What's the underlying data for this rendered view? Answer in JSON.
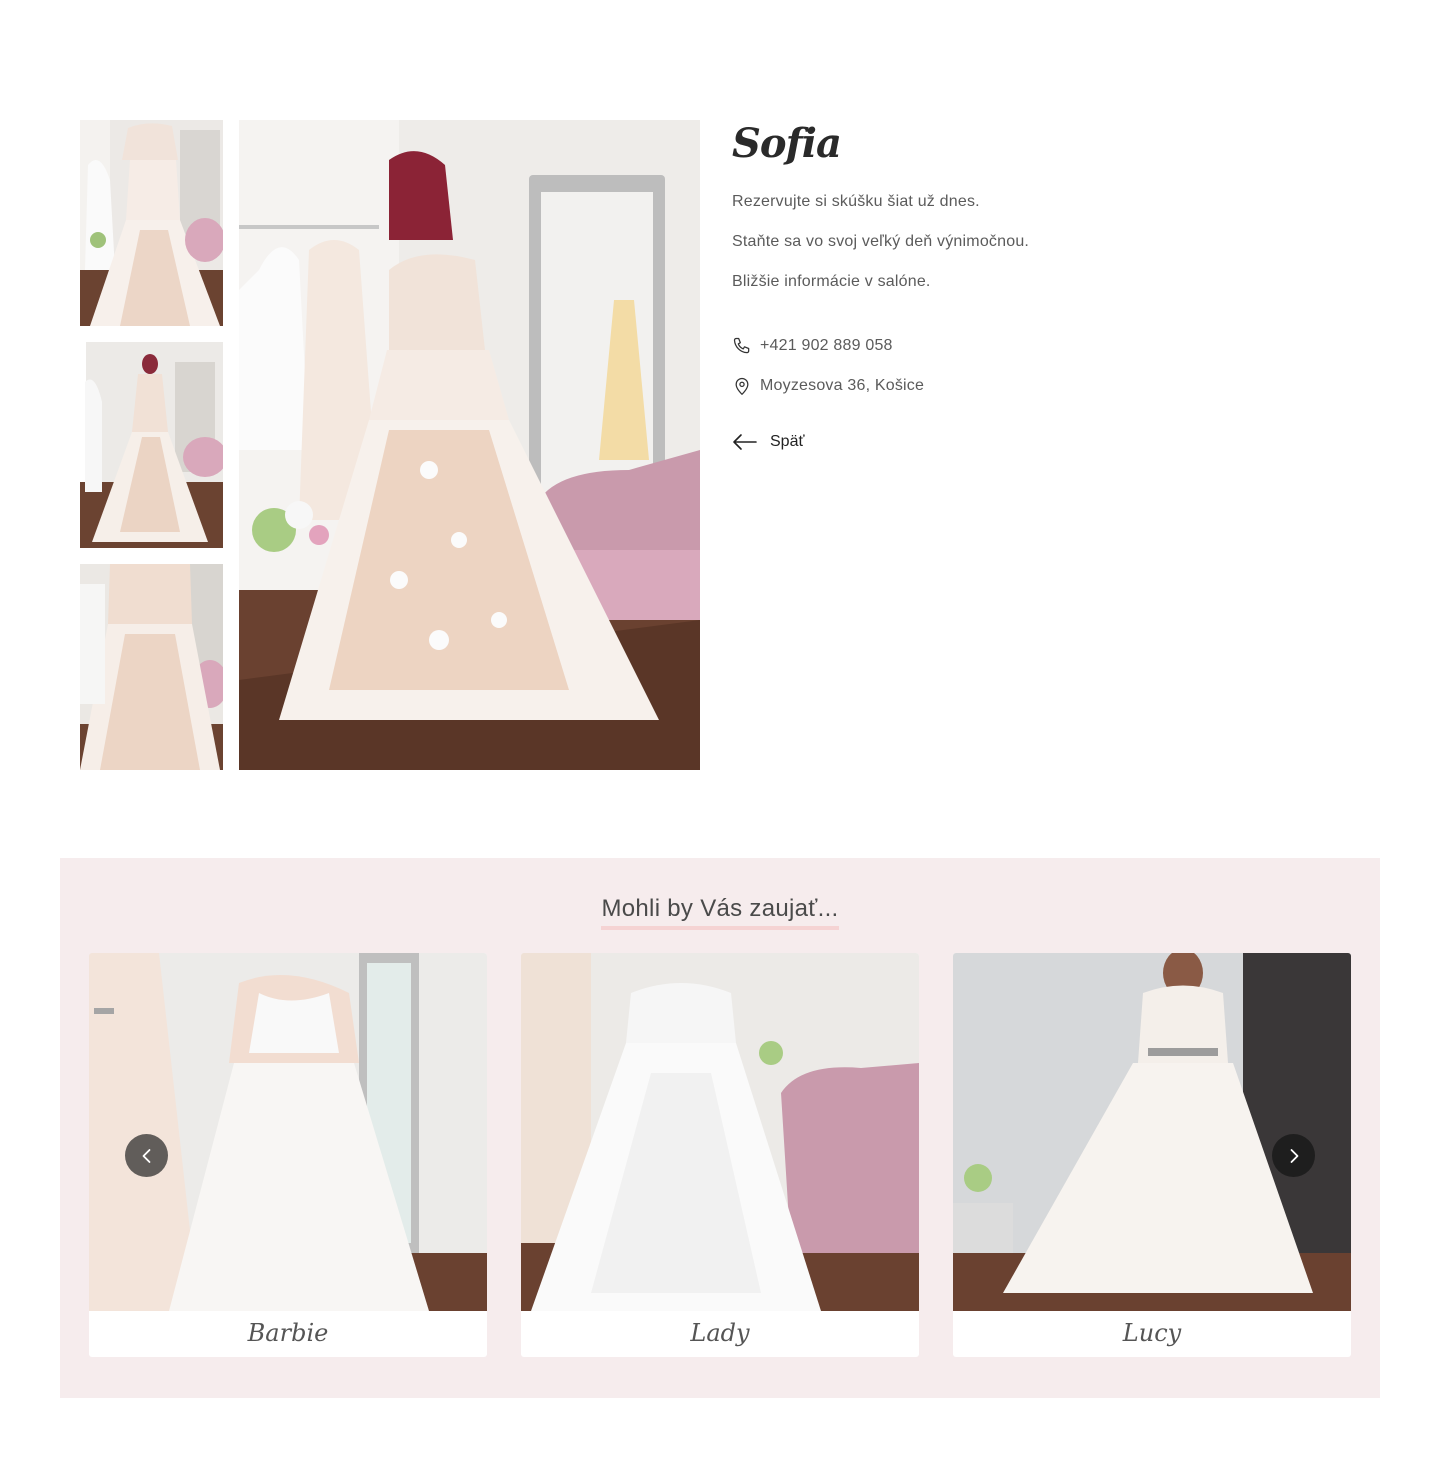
{
  "product": {
    "name": "Sofia",
    "description": [
      "Rezervujte si skúšku šiat už dnes.",
      "Staňte sa vo svoj veľký deň výnimočnou.",
      "Bližšie informácie v salóne."
    ],
    "phone": "+421 902 889 058",
    "address": "Moyzesova 36, Košice",
    "back_label": "Späť",
    "icons": {
      "phone": "phone-icon",
      "address": "map-pin-icon",
      "back": "arrow-left-icon"
    }
  },
  "related": {
    "title": "Mohli by Vás zaujať...",
    "items": [
      {
        "name": "Barbie"
      },
      {
        "name": "Lady"
      },
      {
        "name": "Lucy"
      }
    ],
    "controls": {
      "prev": "chevron-left-icon",
      "next": "chevron-right-icon"
    }
  },
  "colors": {
    "section_background": "#f6eced",
    "title_underline": "#f5d3d3",
    "text": "#5b5b5b"
  }
}
